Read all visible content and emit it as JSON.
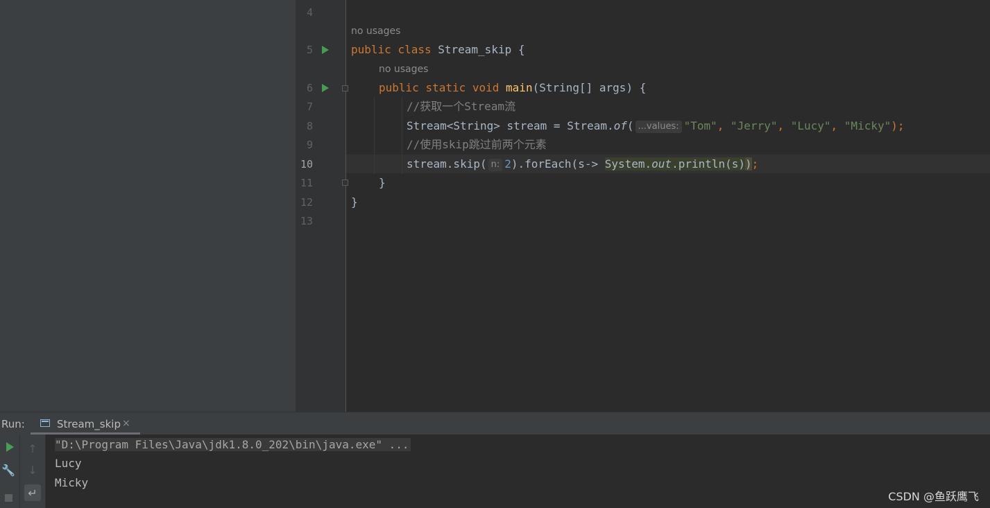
{
  "editor": {
    "line_numbers": [
      "4",
      "5",
      "6",
      "7",
      "8",
      "9",
      "10",
      "11",
      "12",
      "13"
    ],
    "usage_hint_class": "no usages",
    "usage_hint_method": "no usages",
    "lines": {
      "l5": {
        "kw1": "public",
        "kw2": "class",
        "name": "Stream_skip",
        "brace": "{"
      },
      "l6": {
        "kw1": "public",
        "kw2": "static",
        "kw3": "void",
        "fn": "main",
        "rest": "(String[] args) {"
      },
      "l7": {
        "comment": "//获取一个Stream流"
      },
      "l8": {
        "a": "Stream<String> stream = Stream.",
        "of": "of",
        "open": "(",
        "hint": "...values:",
        "s1": "\"Tom\"",
        "c1": ", ",
        "s2": "\"Jerry\"",
        "c2": ", ",
        "s3": "\"Lucy\"",
        "c3": ", ",
        "s4": "\"Micky\"",
        "close": ");"
      },
      "l9": {
        "comment": "//使用skip跳过前两个元素"
      },
      "l10": {
        "a": "stream.skip(",
        "hint": "n:",
        "num": "2",
        "b": ").forEach(s-> ",
        "sys": "System.",
        "out": "out",
        "println": ".println(s)",
        "paren": ")",
        "semi": ";"
      },
      "l11": {
        "brace": "}"
      },
      "l12": {
        "brace": "}"
      }
    }
  },
  "run_panel": {
    "label": "Run:",
    "tab_label": "Stream_skip",
    "tab_close": "×",
    "console": [
      "\"D:\\Program Files\\Java\\jdk1.8.0_202\\bin\\java.exe\" ...",
      "Lucy",
      "Micky"
    ],
    "toolbar_icons": [
      "run-icon",
      "wrench-icon",
      "stop-icon",
      "arrow-up-icon",
      "arrow-down-icon",
      "soft-wrap-icon"
    ]
  },
  "watermark": "CSDN @鱼跃鹰飞",
  "colors": {
    "keyword": "#cc7832",
    "function": "#ffc66d",
    "string": "#6a8759",
    "number": "#6897bb",
    "comment": "#808080",
    "static_field": "#9876aa",
    "run_green": "#499c54"
  }
}
